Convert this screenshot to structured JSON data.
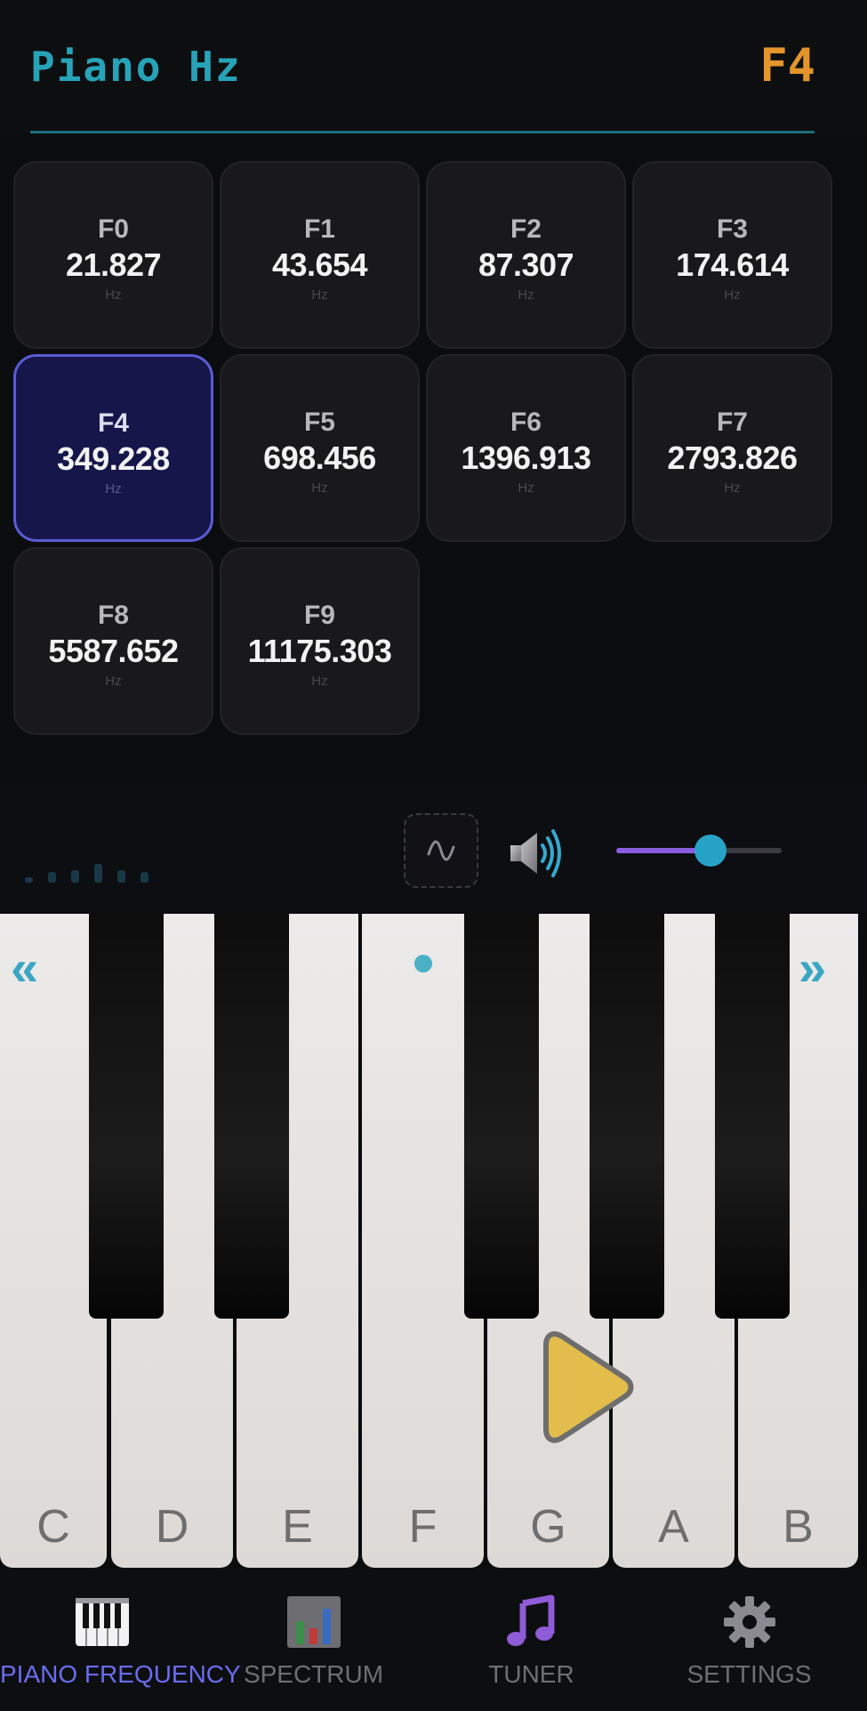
{
  "header": {
    "title": "Piano Hz",
    "current_note": "F4"
  },
  "grid": {
    "unit": "Hz",
    "cells": [
      {
        "note": "F0",
        "freq": "21.827"
      },
      {
        "note": "F1",
        "freq": "43.654"
      },
      {
        "note": "F2",
        "freq": "87.307"
      },
      {
        "note": "F3",
        "freq": "174.614"
      },
      {
        "note": "F4",
        "freq": "349.228",
        "selected": true
      },
      {
        "note": "F5",
        "freq": "698.456"
      },
      {
        "note": "F6",
        "freq": "1396.913"
      },
      {
        "note": "F7",
        "freq": "2793.826"
      },
      {
        "note": "F8",
        "freq": "5587.652"
      },
      {
        "note": "F9",
        "freq": "11175.303"
      }
    ]
  },
  "controls": {
    "wave_icon": "sine-wave-icon",
    "speaker_icon": "speaker-icon",
    "volume_fraction": 0.57,
    "accent": "#8a5ce0",
    "knob_color": "#27a3c8"
  },
  "keyboard": {
    "prev_arrow": "«",
    "next_arrow": "»",
    "white_keys": [
      "C",
      "D",
      "E",
      "F",
      "G",
      "A",
      "B"
    ]
  },
  "nav": {
    "items": [
      {
        "label": "PIANO FREQUENCY",
        "icon": "piano-icon",
        "active": true
      },
      {
        "label": "SPECTRUM",
        "icon": "bar-chart-icon"
      },
      {
        "label": "TUNER",
        "icon": "music-note-icon"
      },
      {
        "label": "SETTINGS",
        "icon": "gear-icon"
      }
    ]
  }
}
